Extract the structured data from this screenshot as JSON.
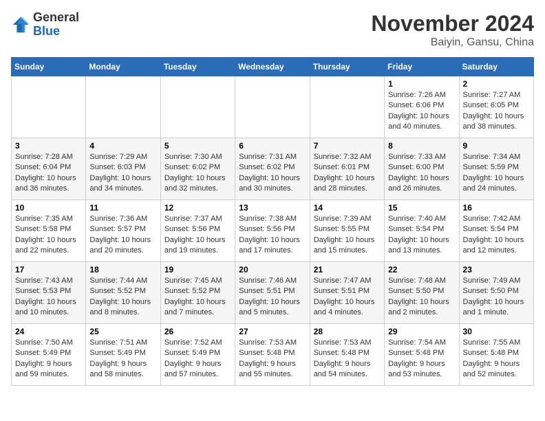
{
  "header": {
    "logo_general": "General",
    "logo_blue": "Blue",
    "month_title": "November 2024",
    "location": "Baiyin, Gansu, China"
  },
  "weekdays": [
    "Sunday",
    "Monday",
    "Tuesday",
    "Wednesday",
    "Thursday",
    "Friday",
    "Saturday"
  ],
  "weeks": [
    [
      {
        "day": "",
        "info": ""
      },
      {
        "day": "",
        "info": ""
      },
      {
        "day": "",
        "info": ""
      },
      {
        "day": "",
        "info": ""
      },
      {
        "day": "",
        "info": ""
      },
      {
        "day": "1",
        "info": "Sunrise: 7:26 AM\nSunset: 6:06 PM\nDaylight: 10 hours and 40 minutes."
      },
      {
        "day": "2",
        "info": "Sunrise: 7:27 AM\nSunset: 6:05 PM\nDaylight: 10 hours and 38 minutes."
      }
    ],
    [
      {
        "day": "3",
        "info": "Sunrise: 7:28 AM\nSunset: 6:04 PM\nDaylight: 10 hours and 36 minutes."
      },
      {
        "day": "4",
        "info": "Sunrise: 7:29 AM\nSunset: 6:03 PM\nDaylight: 10 hours and 34 minutes."
      },
      {
        "day": "5",
        "info": "Sunrise: 7:30 AM\nSunset: 6:02 PM\nDaylight: 10 hours and 32 minutes."
      },
      {
        "day": "6",
        "info": "Sunrise: 7:31 AM\nSunset: 6:02 PM\nDaylight: 10 hours and 30 minutes."
      },
      {
        "day": "7",
        "info": "Sunrise: 7:32 AM\nSunset: 6:01 PM\nDaylight: 10 hours and 28 minutes."
      },
      {
        "day": "8",
        "info": "Sunrise: 7:33 AM\nSunset: 6:00 PM\nDaylight: 10 hours and 26 minutes."
      },
      {
        "day": "9",
        "info": "Sunrise: 7:34 AM\nSunset: 5:59 PM\nDaylight: 10 hours and 24 minutes."
      }
    ],
    [
      {
        "day": "10",
        "info": "Sunrise: 7:35 AM\nSunset: 5:58 PM\nDaylight: 10 hours and 22 minutes."
      },
      {
        "day": "11",
        "info": "Sunrise: 7:36 AM\nSunset: 5:57 PM\nDaylight: 10 hours and 20 minutes."
      },
      {
        "day": "12",
        "info": "Sunrise: 7:37 AM\nSunset: 5:56 PM\nDaylight: 10 hours and 19 minutes."
      },
      {
        "day": "13",
        "info": "Sunrise: 7:38 AM\nSunset: 5:56 PM\nDaylight: 10 hours and 17 minutes."
      },
      {
        "day": "14",
        "info": "Sunrise: 7:39 AM\nSunset: 5:55 PM\nDaylight: 10 hours and 15 minutes."
      },
      {
        "day": "15",
        "info": "Sunrise: 7:40 AM\nSunset: 5:54 PM\nDaylight: 10 hours and 13 minutes."
      },
      {
        "day": "16",
        "info": "Sunrise: 7:42 AM\nSunset: 5:54 PM\nDaylight: 10 hours and 12 minutes."
      }
    ],
    [
      {
        "day": "17",
        "info": "Sunrise: 7:43 AM\nSunset: 5:53 PM\nDaylight: 10 hours and 10 minutes."
      },
      {
        "day": "18",
        "info": "Sunrise: 7:44 AM\nSunset: 5:52 PM\nDaylight: 10 hours and 8 minutes."
      },
      {
        "day": "19",
        "info": "Sunrise: 7:45 AM\nSunset: 5:52 PM\nDaylight: 10 hours and 7 minutes."
      },
      {
        "day": "20",
        "info": "Sunrise: 7:46 AM\nSunset: 5:51 PM\nDaylight: 10 hours and 5 minutes."
      },
      {
        "day": "21",
        "info": "Sunrise: 7:47 AM\nSunset: 5:51 PM\nDaylight: 10 hours and 4 minutes."
      },
      {
        "day": "22",
        "info": "Sunrise: 7:48 AM\nSunset: 5:50 PM\nDaylight: 10 hours and 2 minutes."
      },
      {
        "day": "23",
        "info": "Sunrise: 7:49 AM\nSunset: 5:50 PM\nDaylight: 10 hours and 1 minute."
      }
    ],
    [
      {
        "day": "24",
        "info": "Sunrise: 7:50 AM\nSunset: 5:49 PM\nDaylight: 9 hours and 59 minutes."
      },
      {
        "day": "25",
        "info": "Sunrise: 7:51 AM\nSunset: 5:49 PM\nDaylight: 9 hours and 58 minutes."
      },
      {
        "day": "26",
        "info": "Sunrise: 7:52 AM\nSunset: 5:49 PM\nDaylight: 9 hours and 57 minutes."
      },
      {
        "day": "27",
        "info": "Sunrise: 7:53 AM\nSunset: 5:48 PM\nDaylight: 9 hours and 55 minutes."
      },
      {
        "day": "28",
        "info": "Sunrise: 7:53 AM\nSunset: 5:48 PM\nDaylight: 9 hours and 54 minutes."
      },
      {
        "day": "29",
        "info": "Sunrise: 7:54 AM\nSunset: 5:48 PM\nDaylight: 9 hours and 53 minutes."
      },
      {
        "day": "30",
        "info": "Sunrise: 7:55 AM\nSunset: 5:48 PM\nDaylight: 9 hours and 52 minutes."
      }
    ]
  ]
}
